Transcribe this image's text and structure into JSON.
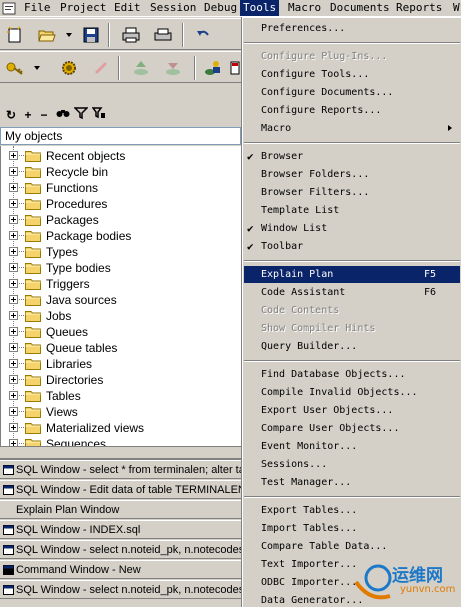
{
  "menubar": {
    "items": [
      {
        "label": "File",
        "underline": "F"
      },
      {
        "label": "Project"
      },
      {
        "label": "Edit"
      },
      {
        "label": "Session"
      },
      {
        "label": "Debug"
      },
      {
        "label": "Tools",
        "active": true
      },
      {
        "label": "Macro"
      },
      {
        "label": "Documents"
      },
      {
        "label": "Reports"
      },
      {
        "label": "W"
      }
    ]
  },
  "object_browser": {
    "selected": "My objects",
    "items": [
      "Recent objects",
      "Recycle bin",
      "Functions",
      "Procedures",
      "Packages",
      "Package bodies",
      "Types",
      "Type bodies",
      "Triggers",
      "Java sources",
      "Jobs",
      "Queues",
      "Queue tables",
      "Libraries",
      "Directories",
      "Tables",
      "Views",
      "Materialized views",
      "Sequences"
    ]
  },
  "window_list": {
    "items": [
      {
        "label": "SQL Window - select * from terminalen; alter tab",
        "icon": "sql-window-icon"
      },
      {
        "label": "SQL Window - Edit data of table TERMINALEN",
        "icon": "sql-window-icon"
      },
      {
        "label": "Explain Plan Window",
        "icon": ""
      },
      {
        "label": "SQL Window - INDEX.sql",
        "icon": "sql-window-icon"
      },
      {
        "label": "SQL Window - select n.noteid_pk, n.notecodes",
        "icon": "sql-window-icon"
      },
      {
        "label": "Command Window - New",
        "icon": "command-window-icon"
      },
      {
        "label": "SQL Window - select n.noteid_pk, n.notecodes",
        "icon": "sql-window-icon"
      }
    ]
  },
  "tools_menu": {
    "groups": [
      [
        {
          "label": "Preferences..."
        }
      ],
      [
        {
          "label": "Configure Plug-Ins...",
          "disabled": true
        },
        {
          "label": "Configure Tools..."
        },
        {
          "label": "Configure Documents..."
        },
        {
          "label": "Configure Reports..."
        },
        {
          "label": "Macro",
          "submenu": true
        }
      ],
      [
        {
          "label": "Browser",
          "checked": true
        },
        {
          "label": "Browser Folders..."
        },
        {
          "label": "Browser Filters..."
        },
        {
          "label": "Template List"
        },
        {
          "label": "Window List",
          "checked": true
        },
        {
          "label": "Toolbar",
          "checked": true
        }
      ],
      [
        {
          "label": "Explain Plan",
          "shortcut": "F5",
          "highlighted": true
        },
        {
          "label": "Code Assistant",
          "shortcut": "F6"
        },
        {
          "label": "Code Contents",
          "disabled": true
        },
        {
          "label": "Show Compiler Hints",
          "disabled": true
        },
        {
          "label": "Query Builder..."
        }
      ],
      [
        {
          "label": "Find Database Objects..."
        },
        {
          "label": "Compile Invalid Objects..."
        },
        {
          "label": "Export User Objects..."
        },
        {
          "label": "Compare User Objects..."
        },
        {
          "label": "Event Monitor..."
        },
        {
          "label": "Sessions..."
        },
        {
          "label": "Test Manager..."
        }
      ],
      [
        {
          "label": "Export Tables..."
        },
        {
          "label": "Import Tables..."
        },
        {
          "label": "Compare Table Data..."
        },
        {
          "label": "Text Importer..."
        },
        {
          "label": "ODBC Importer..."
        },
        {
          "label": "Data Generator..."
        }
      ]
    ]
  },
  "watermark": {
    "text": "运维网",
    "url": "yunvn.com"
  },
  "colors": {
    "menu_bg": "#d4d0c8",
    "highlight": "#0a246a",
    "folder": "#f5d36b"
  }
}
